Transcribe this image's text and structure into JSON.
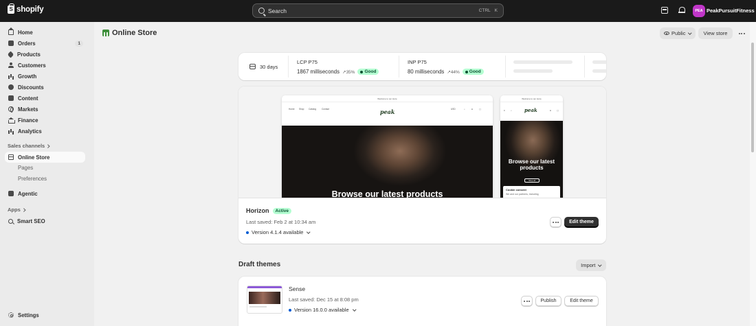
{
  "topbar": {
    "logo_text": "shopify",
    "search_placeholder": "Search",
    "shortcut_key1": "CTRL",
    "shortcut_key2": "K",
    "avatar_initials": "PEA",
    "store_name": "PeakPursuitFitness"
  },
  "sidebar": {
    "items": [
      {
        "label": "Home",
        "icon": "home-icon"
      },
      {
        "label": "Orders",
        "icon": "orders-icon",
        "badge": "1"
      },
      {
        "label": "Products",
        "icon": "tag-icon"
      },
      {
        "label": "Customers",
        "icon": "person-icon"
      },
      {
        "label": "Growth",
        "icon": "growth-icon"
      },
      {
        "label": "Discounts",
        "icon": "discount-icon"
      },
      {
        "label": "Content",
        "icon": "content-icon"
      },
      {
        "label": "Markets",
        "icon": "globe-icon"
      },
      {
        "label": "Finance",
        "icon": "bank-icon"
      },
      {
        "label": "Analytics",
        "icon": "bar-chart-icon"
      }
    ],
    "sales_channels_label": "Sales channels",
    "online_store_label": "Online Store",
    "pages_label": "Pages",
    "preferences_label": "Preferences",
    "agentic_label": "Agentic",
    "apps_label": "Apps",
    "smart_seo_label": "Smart SEO",
    "settings_label": "Settings"
  },
  "header": {
    "title": "Online Store",
    "public_label": "Public",
    "view_store_label": "View store"
  },
  "metrics": {
    "period": "30 days",
    "lcp_title": "LCP P75",
    "lcp_value": "1867 milliseconds",
    "lcp_change": "35%",
    "lcp_status": "Good",
    "inp_title": "INP P75",
    "inp_value": "80 milliseconds",
    "inp_change": "44%",
    "inp_status": "Good"
  },
  "preview": {
    "announcement": "Welcome to our store",
    "brand": "peak",
    "nav": [
      "Home",
      "Shop",
      "Catalog",
      "Contact"
    ],
    "currency": "USD",
    "hero_desktop": "Browse our latest products",
    "hero_mobile": "Browse our latest products",
    "shop_all": "Shop all",
    "cookie_title": "Cookie consent",
    "cookie_text": "We and our partners, including"
  },
  "current_theme": {
    "name": "Horizon",
    "status": "Active",
    "last_saved": "Last saved: Feb 2 at 10:34 am",
    "version": "Version 4.1.4 available",
    "edit_label": "Edit theme"
  },
  "drafts": {
    "title": "Draft themes",
    "import_label": "Import",
    "theme": {
      "name": "Sense",
      "last_saved": "Last saved: Dec 15 at 8:08 pm",
      "version": "Version 16.0.0 available",
      "publish_label": "Publish",
      "edit_label": "Edit theme"
    }
  },
  "colors": {
    "topbar": "#1a1a1a",
    "good_badge_bg": "#b4fed2",
    "good_badge_text": "#0c5132",
    "avatar": "#c036c8",
    "version_dot": "#005bd3"
  }
}
